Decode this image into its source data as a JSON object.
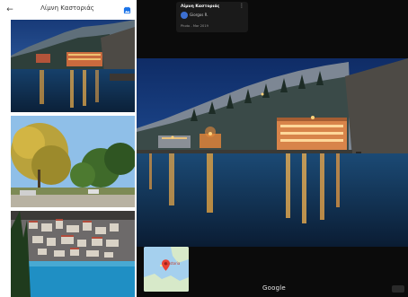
{
  "app": {
    "place_name": "Λίμνη Καστοριάς"
  },
  "left_panel": {
    "title": "Λίμνη Καστοριάς",
    "photos": [
      {
        "name": "lakeside-hotel-night"
      },
      {
        "name": "autumn-trees-park"
      },
      {
        "name": "town-over-lake"
      }
    ]
  },
  "viewer": {
    "info_card": {
      "title": "Λίμνη Καστοριάς",
      "author": "Giorgos R.",
      "date": "Photo - Mar 2019",
      "more_glyph": "⋮"
    },
    "minimap": {
      "label": "Kastoria"
    },
    "attribution": "Google"
  },
  "icons": {
    "back": "arrow-left-icon",
    "collection": "photo-collection-icon",
    "collapse": "chevron-left-icon",
    "more": "more-vert-icon",
    "map_pin": "map-pin-icon"
  },
  "colors": {
    "accent": "#1a73e8",
    "pin": "#ea4335",
    "night_sky": "#0f2c66",
    "lights": "#f2a23a"
  }
}
